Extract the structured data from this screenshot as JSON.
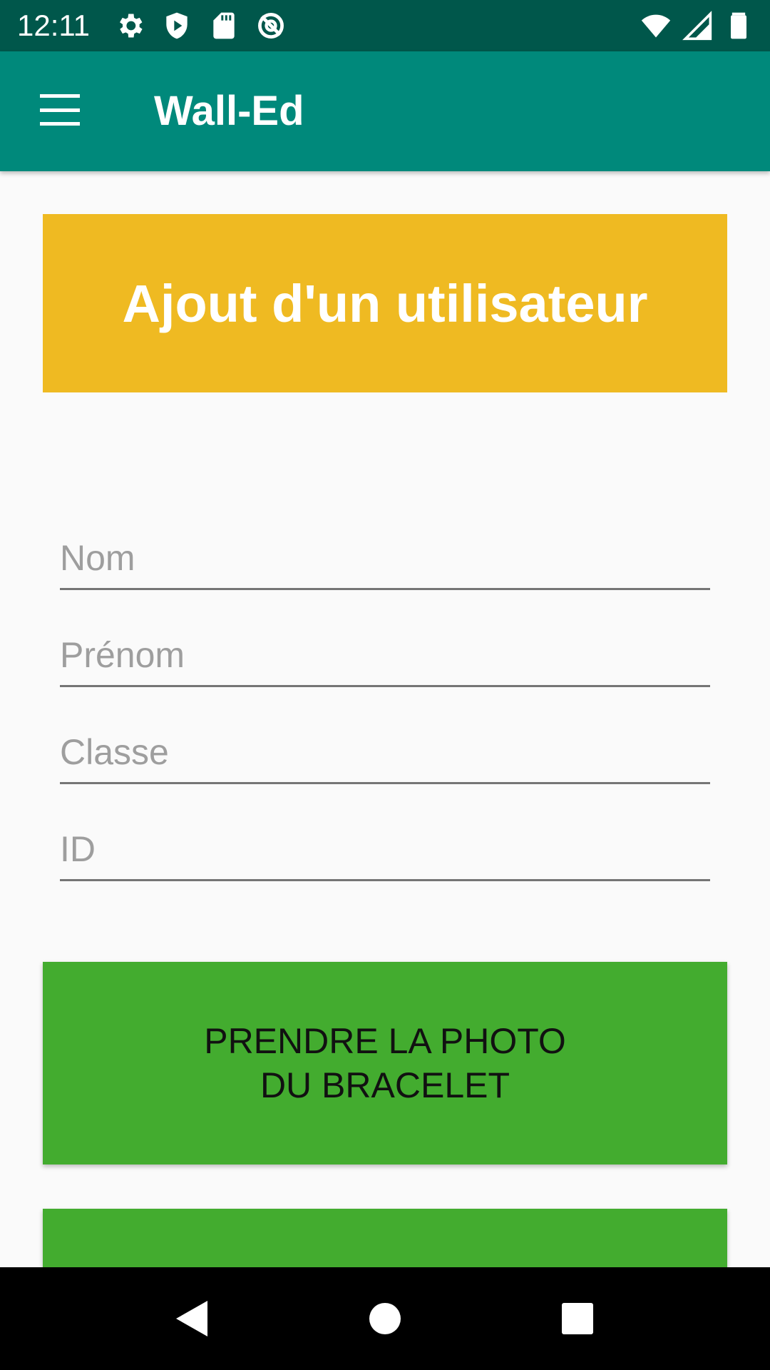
{
  "status_bar": {
    "time": "12:11",
    "left_icons": [
      "settings-icon",
      "shield-icon",
      "sd-card-icon",
      "no-data-icon"
    ],
    "right_icons": [
      "wifi-icon",
      "signal-icon",
      "battery-icon"
    ]
  },
  "app_bar": {
    "title": "Wall-Ed",
    "menu_icon": "hamburger-menu-icon"
  },
  "header": {
    "title": "Ajout d'un utilisateur",
    "color": "#EFBA22"
  },
  "form": {
    "fields": [
      {
        "placeholder": "Nom",
        "value": ""
      },
      {
        "placeholder": "Prénom",
        "value": ""
      },
      {
        "placeholder": "Classe",
        "value": ""
      },
      {
        "placeholder": "ID",
        "value": ""
      }
    ]
  },
  "buttons": {
    "photo_label": "PRENDRE LA PHOTO DU BRACELET",
    "color": "#43AC2F"
  },
  "nav_bar": {
    "icons": [
      "back-icon",
      "home-icon",
      "recents-icon"
    ]
  },
  "colors": {
    "status_bar": "#00574B",
    "app_bar": "#00897B",
    "background": "#FAFAFA"
  }
}
